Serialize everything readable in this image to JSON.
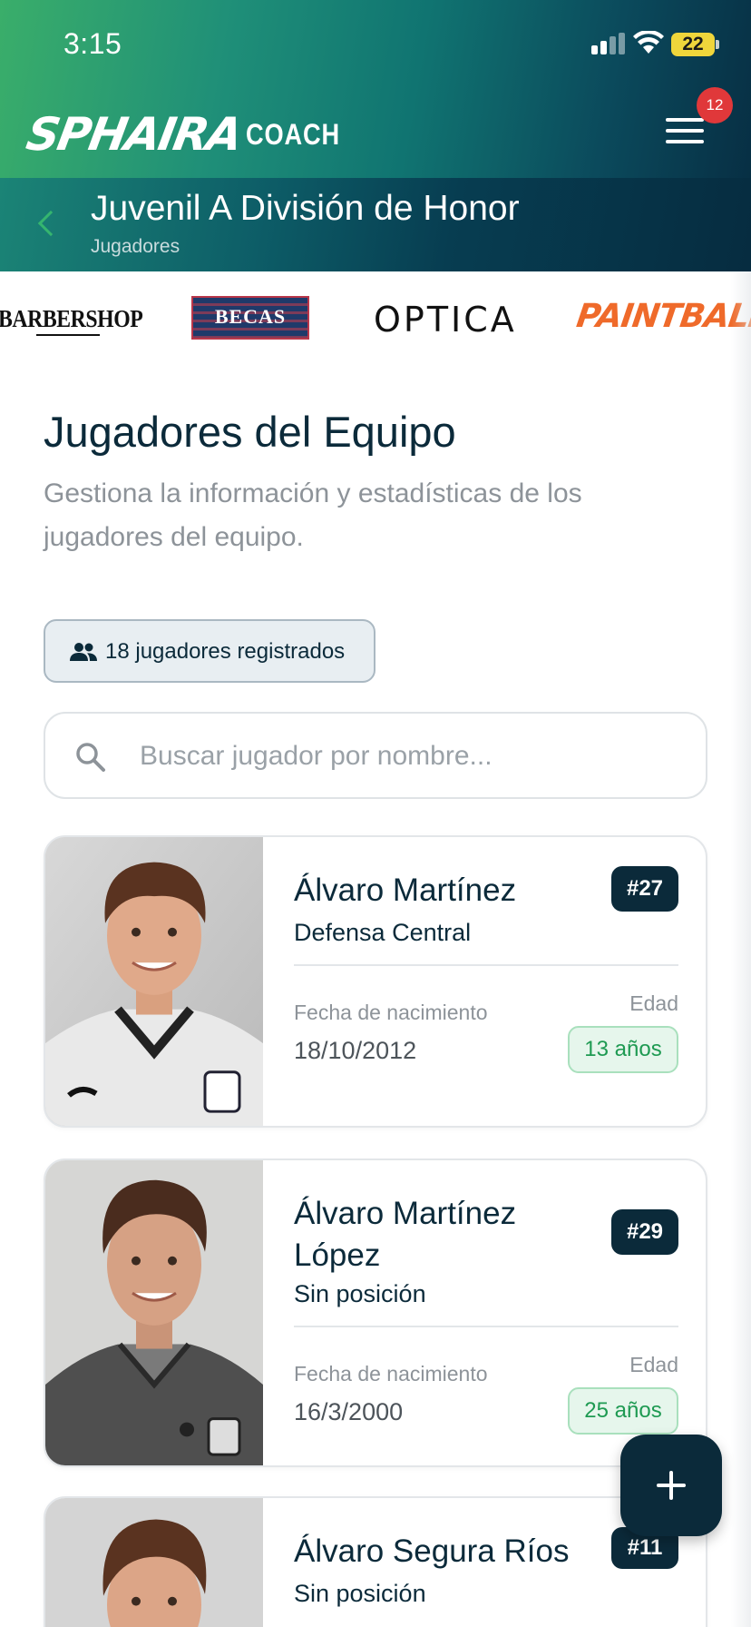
{
  "status_bar": {
    "time": "3:15",
    "battery": "22"
  },
  "header": {
    "logo_main": "SPHAIRA",
    "logo_sub": "COACH",
    "notification_count": "12"
  },
  "subheader": {
    "title": "Juvenil A División de Honor",
    "caption": "Jugadores"
  },
  "sponsors": [
    {
      "name": "BARBERSHOP"
    },
    {
      "name": "BECAS"
    },
    {
      "name": "OPTICA"
    },
    {
      "name": "PAINTBALL"
    }
  ],
  "page": {
    "title": "Jugadores del Equipo",
    "description": "Gestiona la información y estadísticas de los jugadores del equipo."
  },
  "players_count_label": "18 jugadores registrados",
  "search": {
    "placeholder": "Buscar jugador por nombre...",
    "value": ""
  },
  "players": [
    {
      "name": "Álvaro Martínez",
      "position": "Defensa Central",
      "number": "#27",
      "dob_label": "Fecha de nacimiento",
      "dob": "18/10/2012",
      "age_label": "Edad",
      "age": "13 años"
    },
    {
      "name": "Álvaro Martínez López",
      "position": "Sin posición",
      "number": "#29",
      "dob_label": "Fecha de nacimiento",
      "dob": "16/3/2000",
      "age_label": "Edad",
      "age": "25 años"
    },
    {
      "name": "Álvaro Segura Ríos",
      "position": "Sin posición",
      "number": "#11"
    }
  ],
  "colors": {
    "primary_dark": "#0b2a3a",
    "accent_green": "#3aae6a",
    "age_green": "#1e9a52",
    "badge_red": "#e0383a",
    "paintball_orange": "#ef6a2a"
  },
  "icons": {
    "menu": "hamburger-icon",
    "back": "chevron-left-icon",
    "players": "people-icon",
    "search": "search-icon",
    "add": "plus-icon"
  }
}
